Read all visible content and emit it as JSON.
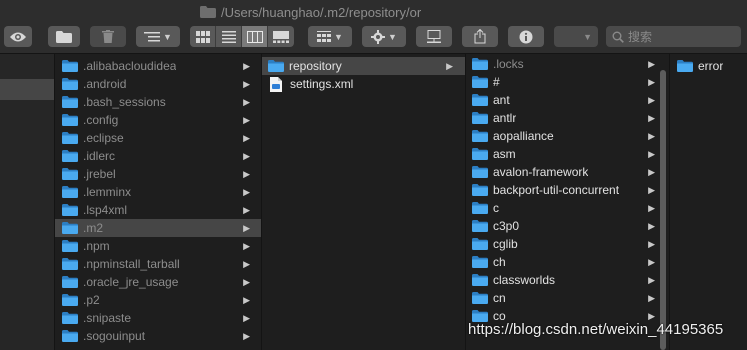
{
  "window": {
    "path": "/Users/huanghao/.m2/repository/or"
  },
  "search": {
    "placeholder": "搜索"
  },
  "columns": {
    "col1": [
      {
        "name": ".alibabacloudidea"
      },
      {
        "name": ".android"
      },
      {
        "name": ".bash_sessions"
      },
      {
        "name": ".config"
      },
      {
        "name": ".eclipse"
      },
      {
        "name": ".idlerc"
      },
      {
        "name": ".jrebel"
      },
      {
        "name": ".lemminx"
      },
      {
        "name": ".lsp4xml"
      },
      {
        "name": ".m2",
        "selected": true
      },
      {
        "name": ".npm"
      },
      {
        "name": ".npminstall_tarball"
      },
      {
        "name": ".oracle_jre_usage"
      },
      {
        "name": ".p2"
      },
      {
        "name": ".snipaste"
      },
      {
        "name": ".sogouinput"
      }
    ],
    "col2": [
      {
        "name": "repository",
        "type": "folder",
        "selected": true
      },
      {
        "name": "settings.xml",
        "type": "file"
      }
    ],
    "col3": [
      {
        "name": ".locks"
      },
      {
        "name": "#"
      },
      {
        "name": "ant"
      },
      {
        "name": "antlr"
      },
      {
        "name": "aopalliance"
      },
      {
        "name": "asm"
      },
      {
        "name": "avalon-framework"
      },
      {
        "name": "backport-util-concurrent"
      },
      {
        "name": "c"
      },
      {
        "name": "c3p0"
      },
      {
        "name": "cglib"
      },
      {
        "name": "ch"
      },
      {
        "name": "classworlds"
      },
      {
        "name": "cn"
      },
      {
        "name": "co"
      }
    ],
    "col4": [
      {
        "name": "error"
      }
    ]
  },
  "watermark": "https://blog.csdn.net/weixin_44195365",
  "colors": {
    "folder": "#3aa0e3",
    "selection": "#464646",
    "background": "#1e1e1e"
  },
  "icons": {
    "toolbar": [
      "eye-icon",
      "folder-icon",
      "trash-icon",
      "list-options-icon",
      "icon-view-icon",
      "list-view-icon",
      "column-view-icon",
      "gallery-view-icon",
      "group-icon",
      "gear-icon",
      "connect-icon",
      "share-icon",
      "info-icon",
      "search-icon"
    ]
  }
}
